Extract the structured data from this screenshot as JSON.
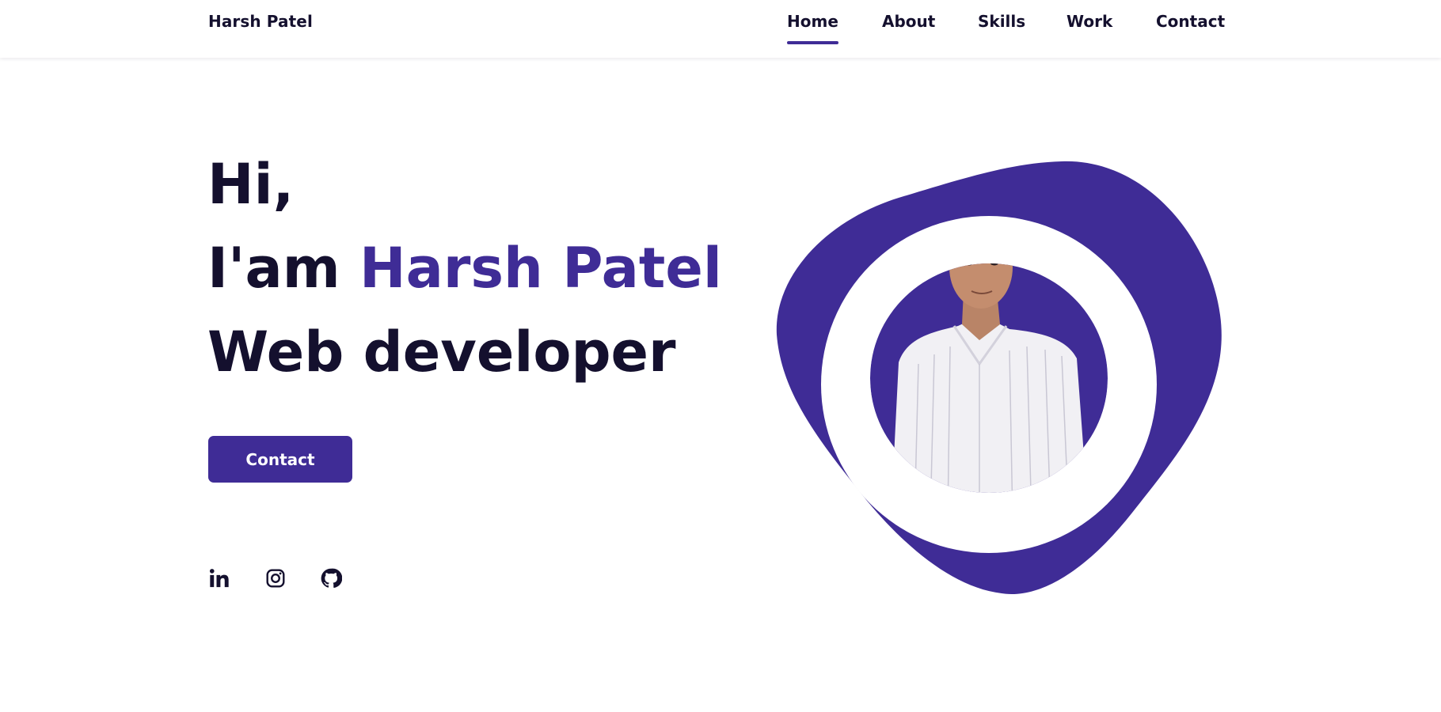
{
  "header": {
    "logo": "Harsh Patel",
    "nav": [
      {
        "label": "Home",
        "active": true
      },
      {
        "label": "About"
      },
      {
        "label": "Skills"
      },
      {
        "label": "Work"
      },
      {
        "label": "Contact"
      }
    ]
  },
  "hero": {
    "greeting": "Hi,",
    "intro_prefix": "I'am ",
    "name": "Harsh Patel",
    "role": "Web developer",
    "cta_label": "Contact"
  },
  "social": [
    {
      "icon": "linkedin-icon"
    },
    {
      "icon": "instagram-icon"
    },
    {
      "icon": "github-icon"
    }
  ],
  "colors": {
    "accent": "#3f2c96",
    "text": "#14102e",
    "background": "#ffffff"
  }
}
